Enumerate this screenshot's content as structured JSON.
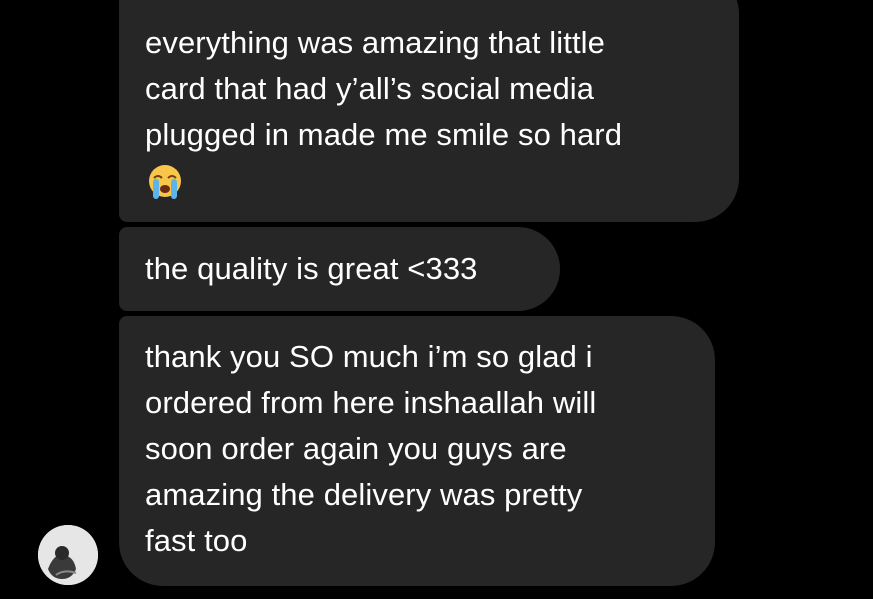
{
  "thread": {
    "messages": [
      {
        "lines": [
          "everything was amazing that little",
          "card that had y’all’s social media",
          "plugged in made me smile so hard"
        ],
        "emoji": "loudly-crying-face-emoji"
      },
      {
        "lines": [
          "the quality is great <333"
        ]
      },
      {
        "lines": [
          "thank you SO much i’m so glad i",
          "ordered from here inshaallah will",
          "soon order again you guys are",
          "amazing the delivery was pretty",
          "fast too"
        ]
      }
    ],
    "avatar": {
      "icon": "profile-photo-avatar"
    }
  },
  "colors": {
    "background": "#000000",
    "bubble": "#262626",
    "text": "#ffffff",
    "avatar_bg": "#e6e6e6"
  }
}
